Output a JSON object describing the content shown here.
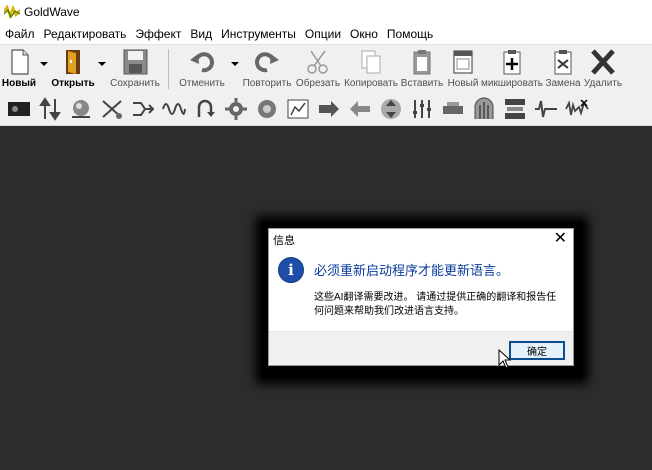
{
  "window": {
    "title": "GoldWave"
  },
  "menu": [
    "Файл",
    "Редактировать",
    "Эффект",
    "Вид",
    "Инструменты",
    "Опции",
    "Окно",
    "Помощь"
  ],
  "toolbar": {
    "new": "Новый",
    "open": "Открыть",
    "save": "Сохранить",
    "undo": "Отменить",
    "redo": "Повторить",
    "cut": "Обрезать",
    "copy": "Копировать",
    "paste": "Вставить",
    "paste_new": "Новый",
    "mix": "микшировать",
    "replace": "Замена",
    "delete": "Удалить"
  },
  "toolbar2": [
    "view-icon",
    "resize-vertical-icon",
    "sphere-icon",
    "cross-channel-icon",
    "merge-icon",
    "wave-icon",
    "u-turn-icon",
    "gear-icon",
    "swirl-icon",
    "chart-icon",
    "arrows-right-icon",
    "arrow-left-icon",
    "arrows-vertical-icon",
    "equalizer-icon",
    "compressor-icon",
    "gate-icon",
    "filter-icon",
    "noise-icon",
    "spike-icon"
  ],
  "dialog": {
    "title": "信息",
    "close": "✕",
    "icon": "i",
    "heading": "必须重新启动程序才能更新语言。",
    "body": "这些AI翻译需要改进。 请通过提供正确的翻译和报告任何问题来帮助我们改进语言支持。",
    "ok": "确定"
  },
  "colors": {
    "workspace": "#2c2c2c",
    "toolbar": "#f0f0f0",
    "heading": "#0a3b9c",
    "info_icon": "#1f4ea8",
    "ok_border": "#0d4d8e"
  }
}
